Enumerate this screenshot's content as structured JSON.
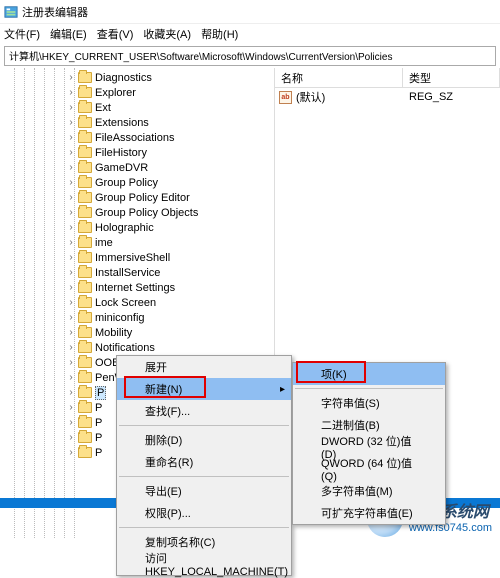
{
  "title": "注册表编辑器",
  "menu": [
    "文件(F)",
    "编辑(E)",
    "查看(V)",
    "收藏夹(A)",
    "帮助(H)"
  ],
  "path": "计算机\\HKEY_CURRENT_USER\\Software\\Microsoft\\Windows\\CurrentVersion\\Policies",
  "tree": [
    "Diagnostics",
    "Explorer",
    "Ext",
    "Extensions",
    "FileAssociations",
    "FileHistory",
    "GameDVR",
    "Group Policy",
    "Group Policy Editor",
    "Group Policy Objects",
    "Holographic",
    "ime",
    "ImmersiveShell",
    "InstallService",
    "Internet Settings",
    "Lock Screen",
    "miniconfig",
    "Mobility",
    "Notifications",
    "OOBE",
    "PenWorkspace"
  ],
  "sel_initial": "P",
  "sel_rest": [
    "P",
    "P",
    "P",
    "P"
  ],
  "list_head": {
    "name": "名称",
    "type": "类型"
  },
  "list_row": {
    "icon": "ab",
    "name": "(默认)",
    "type": "REG_SZ"
  },
  "ctx1": {
    "expand": "展开",
    "new": "新建(N)",
    "find": "查找(F)...",
    "delete": "删除(D)",
    "rename": "重命名(R)",
    "export": "导出(E)",
    "perm": "权限(P)...",
    "copyname": "复制项名称(C)",
    "goto": "访问 HKEY_LOCAL_MACHINE(T)"
  },
  "ctx2": {
    "key": "项(K)",
    "string": "字符串值(S)",
    "binary": "二进制值(B)",
    "dword": "DWORD (32 位)值(D)",
    "qword": "QWORD (64 位)值(Q)",
    "multi": "多字符串值(M)",
    "expand": "可扩充字符串值(E)"
  },
  "watermark": {
    "main": "飞沙系统网",
    "sub": "www.fs0745.com"
  }
}
